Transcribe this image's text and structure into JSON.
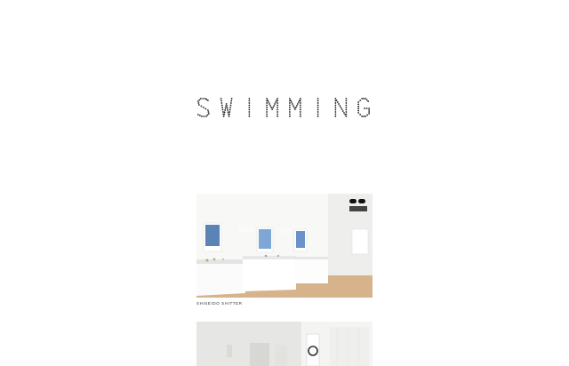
{
  "site": {
    "logo_text": "SWIMMING"
  },
  "projects": [
    {
      "caption": "SHISEIDO SHITTER"
    },
    {
      "caption": ""
    }
  ]
}
